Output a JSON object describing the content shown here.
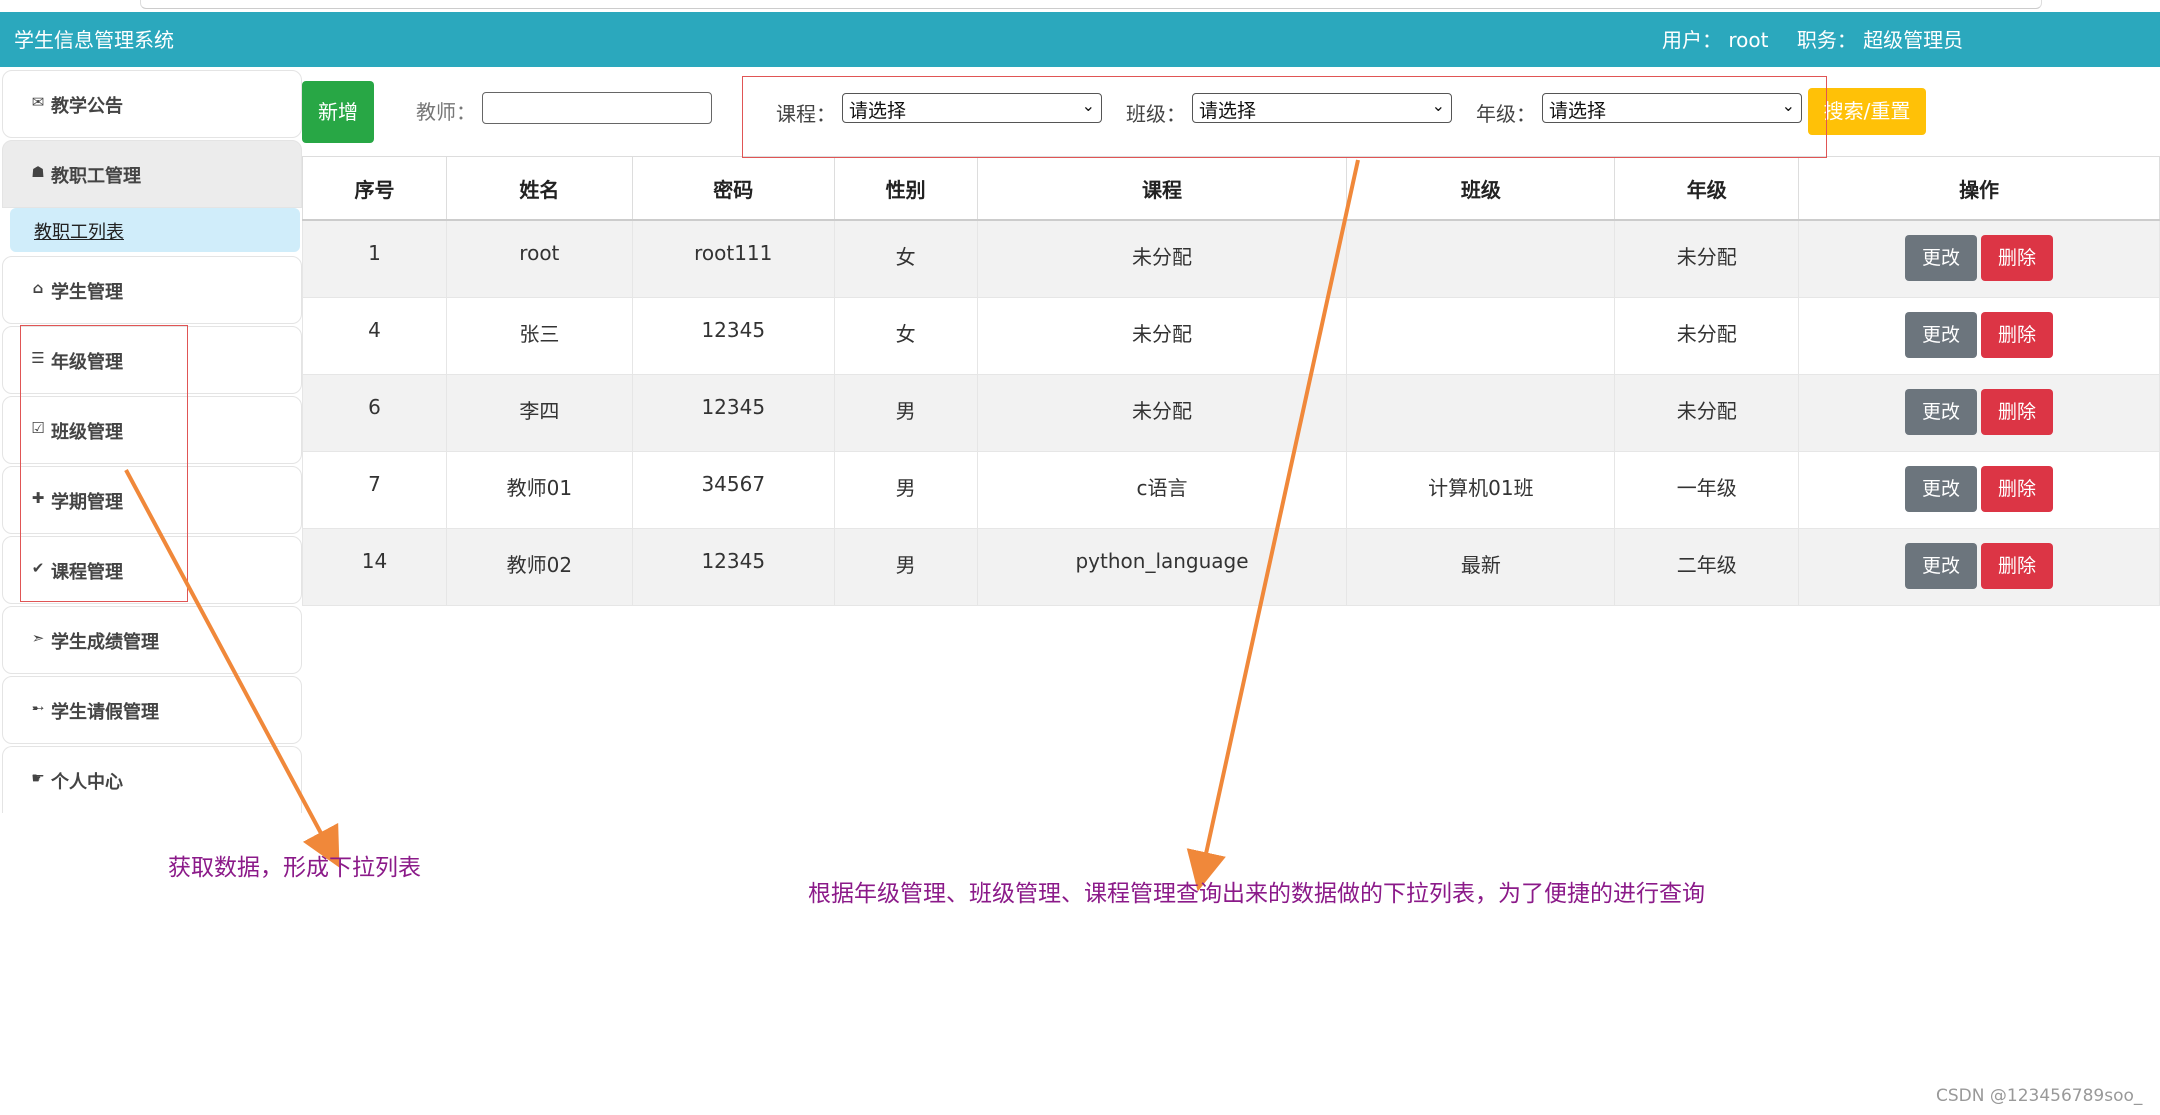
{
  "app": {
    "title": "学生信息管理系统",
    "user_text": "用户： root",
    "role_text": "职务： 超级管理员"
  },
  "sidebar": {
    "items": [
      {
        "icon": "mail-icon",
        "glyph": "✉",
        "label": "教学公告"
      },
      {
        "icon": "person-icon",
        "glyph": "☗",
        "label": "教职工管理",
        "active": true
      },
      {
        "icon": "home-icon",
        "glyph": "⌂",
        "label": "学生管理"
      },
      {
        "icon": "list-icon",
        "glyph": "☰",
        "label": "年级管理"
      },
      {
        "icon": "checkbox-icon",
        "glyph": "☑",
        "label": "班级管理"
      },
      {
        "icon": "plus-icon",
        "glyph": "✚",
        "label": "学期管理"
      },
      {
        "icon": "check-icon",
        "glyph": "✔",
        "label": "课程管理"
      },
      {
        "icon": "send-icon",
        "glyph": "➣",
        "label": "学生成绩管理"
      },
      {
        "icon": "arrow-right-icon",
        "glyph": "➸",
        "label": "学生请假管理"
      },
      {
        "icon": "hand-point-icon",
        "glyph": "☛",
        "label": "个人中心"
      }
    ],
    "sub_item": "教职工列表"
  },
  "toolbar": {
    "add_label": "新增",
    "teacher_label": "教师：",
    "teacher_value": "",
    "course_label": "课程：",
    "course_value": "请选择",
    "class_label": "班级：",
    "class_value": "请选择",
    "grade_label": "年级：",
    "grade_value": "请选择",
    "search_label": "搜索/重置"
  },
  "table": {
    "headers": [
      "序号",
      "姓名",
      "密码",
      "性别",
      "课程",
      "班级",
      "年级",
      "操作"
    ],
    "rows": [
      {
        "id": "1",
        "name": "root",
        "password": "root111",
        "gender": "女",
        "course": "未分配",
        "class": "",
        "grade": "未分配"
      },
      {
        "id": "4",
        "name": "张三",
        "password": "12345",
        "gender": "女",
        "course": "未分配",
        "class": "",
        "grade": "未分配"
      },
      {
        "id": "6",
        "name": "李四",
        "password": "12345",
        "gender": "男",
        "course": "未分配",
        "class": "",
        "grade": "未分配"
      },
      {
        "id": "7",
        "name": "教师01",
        "password": "34567",
        "gender": "男",
        "course": "c语言",
        "class": "计算机01班",
        "grade": "一年级"
      },
      {
        "id": "14",
        "name": "教师02",
        "password": "12345",
        "gender": "男",
        "course": "python_language",
        "class": "最新",
        "grade": "二年级"
      }
    ],
    "edit_label": "更改",
    "delete_label": "删除"
  },
  "annotations": {
    "left_note": "获取数据，形成下拉列表",
    "right_note": "根据年级管理、班级管理、课程管理查询出来的数据做的下拉列表，为了便捷的进行查询",
    "arrow_color": "#f0883a",
    "box_color": "#e05555",
    "text_color": "#8b1a89"
  },
  "watermark": "CSDN @123456789soo_"
}
